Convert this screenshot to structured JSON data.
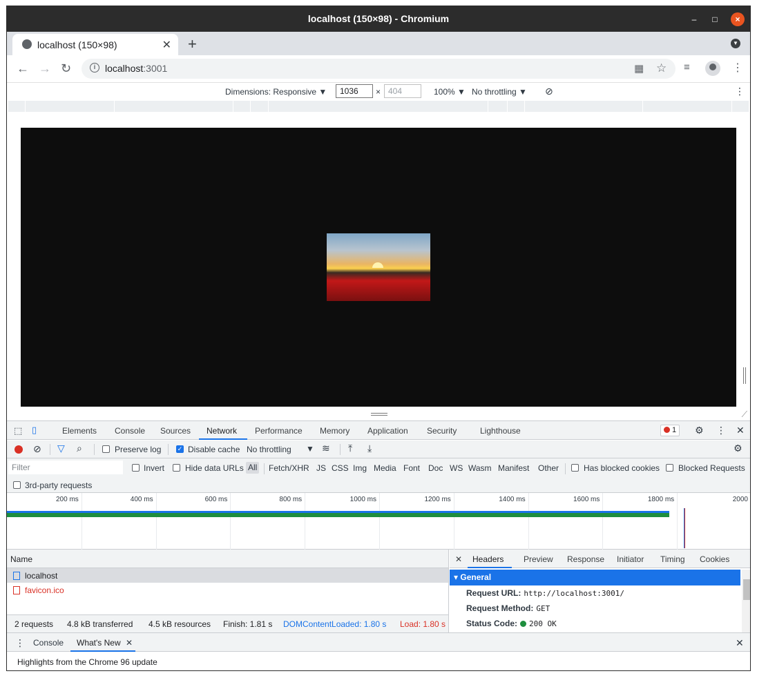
{
  "window": {
    "title": "localhost (150×98) - Chromium"
  },
  "tab": {
    "title": "localhost (150×98)"
  },
  "omnibox": {
    "host": "localhost",
    "port": ":3001"
  },
  "device_toolbar": {
    "dimensions_label": "Dimensions: Responsive ▼",
    "width": "1036",
    "height_placeholder": "404",
    "times": "×",
    "zoom": "100% ▼",
    "throttling": "No throttling ▼"
  },
  "devtools": {
    "tabs": [
      "Elements",
      "Console",
      "Sources",
      "Network",
      "Performance",
      "Memory",
      "Application",
      "Security",
      "Lighthouse"
    ],
    "active_tab": "Network",
    "error_count": "1",
    "network_toolbar": {
      "preserve_log": "Preserve log",
      "disable_cache": "Disable cache",
      "throttling": "No throttling"
    },
    "filter_bar": {
      "placeholder": "Filter",
      "invert": "Invert",
      "hide_data_urls": "Hide data URLs",
      "types": [
        "All",
        "Fetch/XHR",
        "JS",
        "CSS",
        "Img",
        "Media",
        "Font",
        "Doc",
        "WS",
        "Wasm",
        "Manifest",
        "Other"
      ],
      "has_blocked_cookies": "Has blocked cookies",
      "blocked_requests": "Blocked Requests",
      "third_party": "3rd-party requests"
    },
    "timeline": {
      "ticks": [
        "200 ms",
        "400 ms",
        "600 ms",
        "800 ms",
        "1000 ms",
        "1200 ms",
        "1400 ms",
        "1600 ms",
        "1800 ms",
        "2000"
      ],
      "range_ms": [
        0,
        2000
      ],
      "bar_end_ms": 1780,
      "dcl_ms": 1800,
      "load_ms": 1800,
      "colors": {
        "dcl": "#1a73e8",
        "load": "#d93025",
        "bar": "#1e8e3e"
      }
    },
    "request_list": {
      "column": "Name",
      "rows": [
        {
          "name": "localhost",
          "status": "ok"
        },
        {
          "name": "favicon.ico",
          "status": "error"
        }
      ],
      "summary": {
        "requests": "2 requests",
        "transferred": "4.8 kB transferred",
        "resources": "4.5 kB resources",
        "finish": "Finish: 1.81 s",
        "dcl": "DOMContentLoaded: 1.80 s",
        "load": "Load: 1.80 s"
      }
    },
    "details": {
      "tabs": [
        "Headers",
        "Preview",
        "Response",
        "Initiator",
        "Timing",
        "Cookies"
      ],
      "active_tab": "Headers",
      "section": "General",
      "fields": [
        {
          "key": "Request URL:",
          "value": "http://localhost:3001/"
        },
        {
          "key": "Request Method:",
          "value": "GET"
        },
        {
          "key": "Status Code:",
          "value": "200 OK"
        }
      ]
    },
    "drawer": {
      "tabs": [
        "Console",
        "What's New"
      ],
      "active_tab": "What's New",
      "content": "Highlights from the Chrome 96 update"
    }
  }
}
